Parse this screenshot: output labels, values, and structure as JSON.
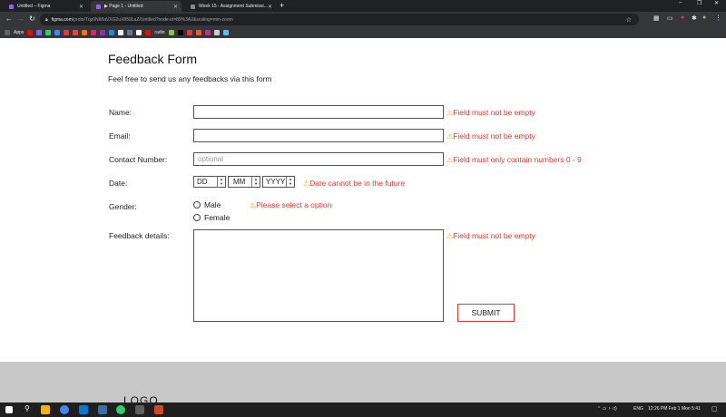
{
  "browser": {
    "tabs": [
      {
        "label": "Untitled – Figma",
        "active": false
      },
      {
        "label": "▶ Page 1 - Untitled",
        "active": true
      },
      {
        "label": "Week 15 - Assignment Submissi...",
        "active": false
      }
    ],
    "new_tab": "+",
    "window_controls": [
      "–",
      "❐",
      "✕"
    ],
    "url_host": "figma.com",
    "url_path": "/proto/Tqz0NII8aVXG2uX859LaZ/Untitled?node-id=89%3A2&scaling=min-zoom",
    "bookmarks_apps_label": "Apps",
    "bookmark_radio_label": "radio"
  },
  "form": {
    "title": "Feedback Form",
    "subtitle": "Feel free to send us any feedbacks via this form",
    "name_label": "Name:",
    "name_error": "Field must not be empty",
    "email_label": "Email:",
    "email_error": "Field must not be empty",
    "contact_label": "Contact Number:",
    "contact_placeholder": "optional",
    "contact_error": "Field must only contain numbers 0 - 9",
    "date_label": "Date:",
    "date_dd": "DD",
    "date_mm": "MM",
    "date_yyyy": "YYYY",
    "date_error": "Date cannot be in the future",
    "gender_label": "Gender:",
    "gender_options": [
      "Male",
      "Female"
    ],
    "gender_error": "Please select a option",
    "feedback_label": "Feedback details:",
    "feedback_error": "Field must not be empty",
    "submit_label": "SUBMIT",
    "warn_icon": "⚠"
  },
  "footer": {
    "logo": "LOGO"
  },
  "taskbar": {
    "lang": "ENG",
    "clock": "12:26 PM  Feb 1 Mon 5:41"
  },
  "colors": {
    "error": "#e53935",
    "warning_icon": "#f5a623",
    "footer_bg": "#c8c8c8"
  }
}
